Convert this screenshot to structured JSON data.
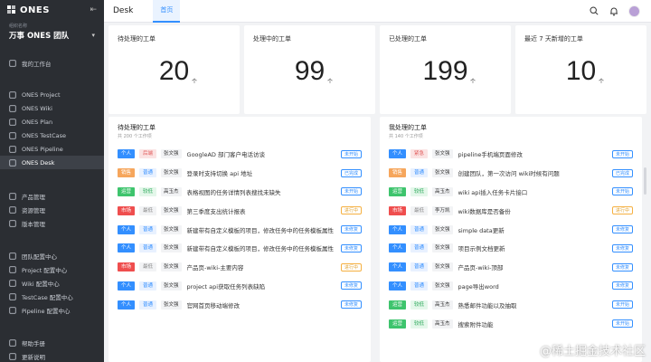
{
  "brand": {
    "logo_text": "ONES"
  },
  "org": {
    "label": "组织名称",
    "name": "万事 ONES 团队"
  },
  "sidebar": {
    "top": [
      {
        "label": "我的工作台",
        "icon": "home-icon"
      }
    ],
    "products": [
      {
        "label": "ONES Project",
        "icon": "project-icon"
      },
      {
        "label": "ONES Wiki",
        "icon": "wiki-icon"
      },
      {
        "label": "ONES Plan",
        "icon": "plan-icon"
      },
      {
        "label": "ONES TestCase",
        "icon": "testcase-icon"
      },
      {
        "label": "ONES Pipeline",
        "icon": "pipeline-icon"
      },
      {
        "label": "ONES Desk",
        "icon": "desk-icon",
        "active": true
      }
    ],
    "management": [
      {
        "label": "产品管理",
        "icon": "product-icon"
      },
      {
        "label": "资源管理",
        "icon": "resource-icon"
      },
      {
        "label": "版本管理",
        "icon": "version-icon"
      }
    ],
    "config": [
      {
        "label": "团队配置中心",
        "icon": "team-config-icon"
      },
      {
        "label": "Project 配置中心",
        "icon": "project-config-icon"
      },
      {
        "label": "Wiki 配置中心",
        "icon": "wiki-config-icon"
      },
      {
        "label": "TestCase 配置中心",
        "icon": "testcase-config-icon"
      },
      {
        "label": "Pipeline 配置中心",
        "icon": "pipeline-config-icon"
      }
    ],
    "bottom": [
      {
        "label": "帮助手册",
        "icon": "help-icon"
      },
      {
        "label": "更新说明",
        "icon": "update-icon"
      }
    ]
  },
  "header": {
    "title": "Desk",
    "tab": "首页"
  },
  "stats": [
    {
      "label": "待处理的工单",
      "value": "20",
      "unit": "个"
    },
    {
      "label": "处理中的工单",
      "value": "99",
      "unit": "个"
    },
    {
      "label": "已处理的工单",
      "value": "199",
      "unit": "个"
    },
    {
      "label": "最近 7 天新增的工单",
      "value": "10",
      "unit": "个"
    }
  ],
  "colors": {
    "个人": {
      "bg": "#338fff",
      "fg": "#ffffff"
    },
    "销售": {
      "bg": "#f6a65c",
      "fg": "#ffffff"
    },
    "运营": {
      "bg": "#3ec46d",
      "fg": "#ffffff"
    },
    "市场": {
      "bg": "#ef4e4e",
      "fg": "#ffffff"
    },
    "后端": {
      "bg": "#fbe3e3",
      "fg": "#e25c5c"
    },
    "紧急": {
      "bg": "#fbe3e3",
      "fg": "#e25c5c"
    },
    "普通": {
      "bg": "#e8f1ff",
      "fg": "#338fff"
    },
    "较低": {
      "bg": "#e4f7ea",
      "fg": "#2eaa5c"
    },
    "最低": {
      "bg": "#f2f3f5",
      "fg": "#888888"
    }
  },
  "pending_panel": {
    "title": "待处理的工单",
    "subtitle": "共 200 个工作项",
    "rows": [
      {
        "category": "个人",
        "priority": "后端",
        "person": "张文强",
        "title": "GoogleAD 部门客户电话访谈",
        "status": "未开始",
        "status_type": "info"
      },
      {
        "category": "销售",
        "priority": "普通",
        "person": "张文强",
        "title": "登录时支持切换 api 地址",
        "status": "已完成",
        "status_type": "info"
      },
      {
        "category": "运营",
        "priority": "较低",
        "person": "高玉杰",
        "title": "表格视图的任务详情列表搜找未缺失",
        "status": "未开始",
        "status_type": "info"
      },
      {
        "category": "市场",
        "priority": "最低",
        "person": "张文强",
        "title": "第三季度支出统计报表",
        "status": "进行中",
        "status_type": "warn"
      },
      {
        "category": "个人",
        "priority": "普通",
        "person": "张文强",
        "title": "新建带有自定义模板的项目，修改任务中的任务模板属性",
        "status": "未修复",
        "status_type": "info"
      },
      {
        "category": "个人",
        "priority": "普通",
        "person": "张文强",
        "title": "新建带有自定义模板的项目，修改任务中的任务模板属性",
        "status": "未修复",
        "status_type": "info"
      },
      {
        "category": "市场",
        "priority": "最低",
        "person": "张文强",
        "title": "产品页-wiki-主要内容",
        "status": "进行中",
        "status_type": "warn"
      },
      {
        "category": "个人",
        "priority": "普通",
        "person": "张文强",
        "title": "project api获取任务列表缺陷",
        "status": "未修复",
        "status_type": "info"
      },
      {
        "category": "个人",
        "priority": "普通",
        "person": "张文强",
        "title": "官网首页移动端修改",
        "status": "未修复",
        "status_type": "info"
      }
    ]
  },
  "my_panel": {
    "title": "我处理的工单",
    "subtitle": "共 140 个工作项",
    "rows": [
      {
        "category": "个人",
        "priority": "紧急",
        "person": "张文强",
        "title": "pipeline手机端页面修改",
        "status": "未开始",
        "status_type": "info"
      },
      {
        "category": "销售",
        "priority": "普通",
        "person": "张文强",
        "title": "创建团队，第一次访问 wiki时候有问题",
        "status": "已完成",
        "status_type": "info"
      },
      {
        "category": "运营",
        "priority": "较低",
        "person": "高玉杰",
        "title": "wiki api插入任务卡片接口",
        "status": "未开始",
        "status_type": "info"
      },
      {
        "category": "市场",
        "priority": "最低",
        "person": "李万凯",
        "title": "wiki数据库是否备份",
        "status": "进行中",
        "status_type": "warn"
      },
      {
        "category": "个人",
        "priority": "普通",
        "person": "张文强",
        "title": "simple data更新",
        "status": "未修复",
        "status_type": "info"
      },
      {
        "category": "个人",
        "priority": "普通",
        "person": "张文强",
        "title": "项目示例文档更新",
        "status": "未修复",
        "status_type": "info"
      },
      {
        "category": "个人",
        "priority": "普通",
        "person": "张文强",
        "title": "产品页-wiki-顶部",
        "status": "未修复",
        "status_type": "info"
      },
      {
        "category": "个人",
        "priority": "普通",
        "person": "张文强",
        "title": "page导出word",
        "status": "未修复",
        "status_type": "info"
      },
      {
        "category": "运营",
        "priority": "较低",
        "person": "高玉杰",
        "title": "熟悉邮件功能以及抽取",
        "status": "未开始",
        "status_type": "info"
      },
      {
        "category": "运营",
        "priority": "较低",
        "person": "高玉杰",
        "title": "搜索附件功能",
        "status": "未开始",
        "status_type": "info"
      }
    ]
  },
  "watermark": "@稀土掘金技术社区"
}
